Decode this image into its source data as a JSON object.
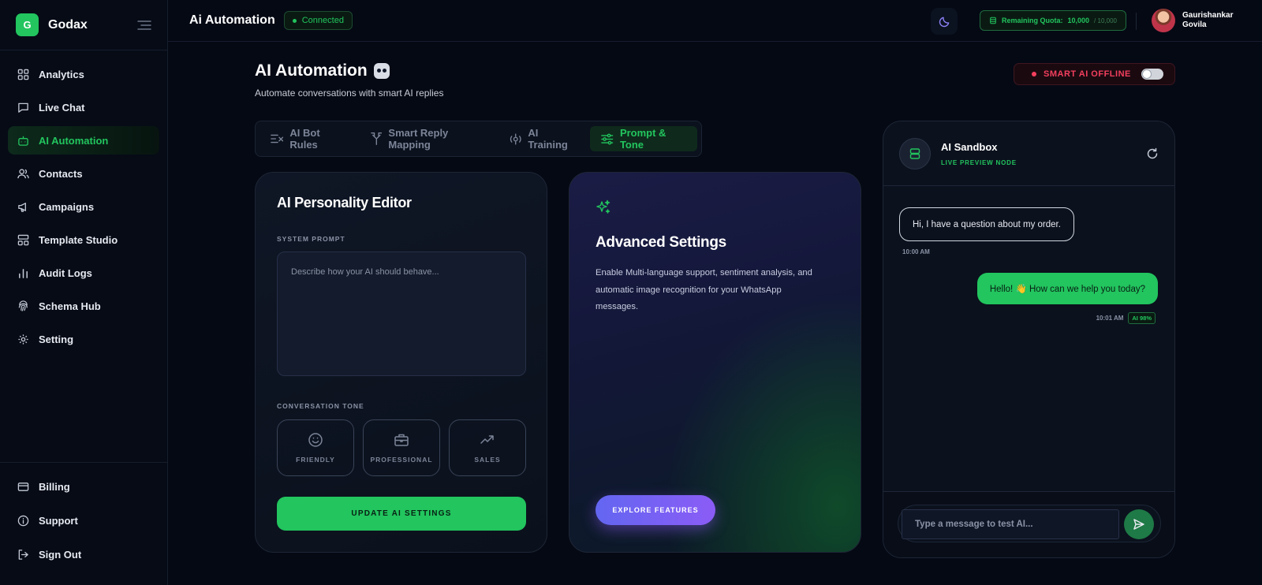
{
  "brand": {
    "logo_letter": "G",
    "name": "Godax",
    "color": "#22c55e"
  },
  "sidebar": {
    "items": [
      {
        "label": "Analytics",
        "icon": "grid-icon"
      },
      {
        "label": "Live Chat",
        "icon": "chat-icon"
      },
      {
        "label": "AI Automation",
        "icon": "robot-icon",
        "active": true
      },
      {
        "label": "Contacts",
        "icon": "users-icon"
      },
      {
        "label": "Campaigns",
        "icon": "megaphone-icon"
      },
      {
        "label": "Template Studio",
        "icon": "layout-icon"
      },
      {
        "label": "Audit Logs",
        "icon": "bar-chart-icon"
      },
      {
        "label": "Schema Hub",
        "icon": "fingerprint-icon"
      },
      {
        "label": "Setting",
        "icon": "gear-icon"
      }
    ],
    "bottom_items": [
      {
        "label": "Billing",
        "icon": "credit-card-icon"
      },
      {
        "label": "Support",
        "icon": "info-icon"
      },
      {
        "label": "Sign Out",
        "icon": "logout-icon"
      }
    ]
  },
  "header": {
    "title": "Ai Automation",
    "status": "Connected",
    "quota_label": "Remaining Quota:",
    "quota_value": "10,000",
    "quota_max": "/ 10,000",
    "user_first": "Gaurishankar",
    "user_last": "Govila"
  },
  "page": {
    "title": "AI Automation",
    "subtitle": "Automate conversations with smart AI replies",
    "smart_ai_status": "SMART AI OFFLINE",
    "toggle_on": false
  },
  "tabs": [
    {
      "label": "AI Bot Rules",
      "icon": "rules-icon"
    },
    {
      "label": "Smart Reply Mapping",
      "icon": "branch-icon"
    },
    {
      "label": "AI Training",
      "icon": "training-icon"
    },
    {
      "label": "Prompt & Tone",
      "icon": "sliders-icon",
      "active": true
    }
  ],
  "editor": {
    "title": "AI Personality Editor",
    "system_prompt_label": "SYSTEM PROMPT",
    "system_prompt_placeholder": "Describe how your AI should behave...",
    "tone_label": "CONVERSATION TONE",
    "tones": [
      {
        "label": "FRIENDLY",
        "icon": "smile-icon"
      },
      {
        "label": "PROFESSIONAL",
        "icon": "briefcase-icon"
      },
      {
        "label": "SALES",
        "icon": "trending-up-icon"
      }
    ],
    "update_button": "UPDATE AI SETTINGS"
  },
  "advanced": {
    "title": "Advanced Settings",
    "description": "Enable Multi-language support, sentiment analysis, and automatic image recognition for your WhatsApp messages.",
    "button": "EXPLORE FEATURES"
  },
  "sandbox": {
    "title": "AI Sandbox",
    "subtitle": "LIVE PREVIEW NODE",
    "messages": [
      {
        "text": "Hi, I have a question about my order.",
        "time": "10:00 AM"
      },
      {
        "text": "Hello! 👋 How can we help you today?",
        "time": "10:01 AM",
        "badge": "AI 98%"
      }
    ],
    "input_placeholder": "Type a message to test AI..."
  }
}
